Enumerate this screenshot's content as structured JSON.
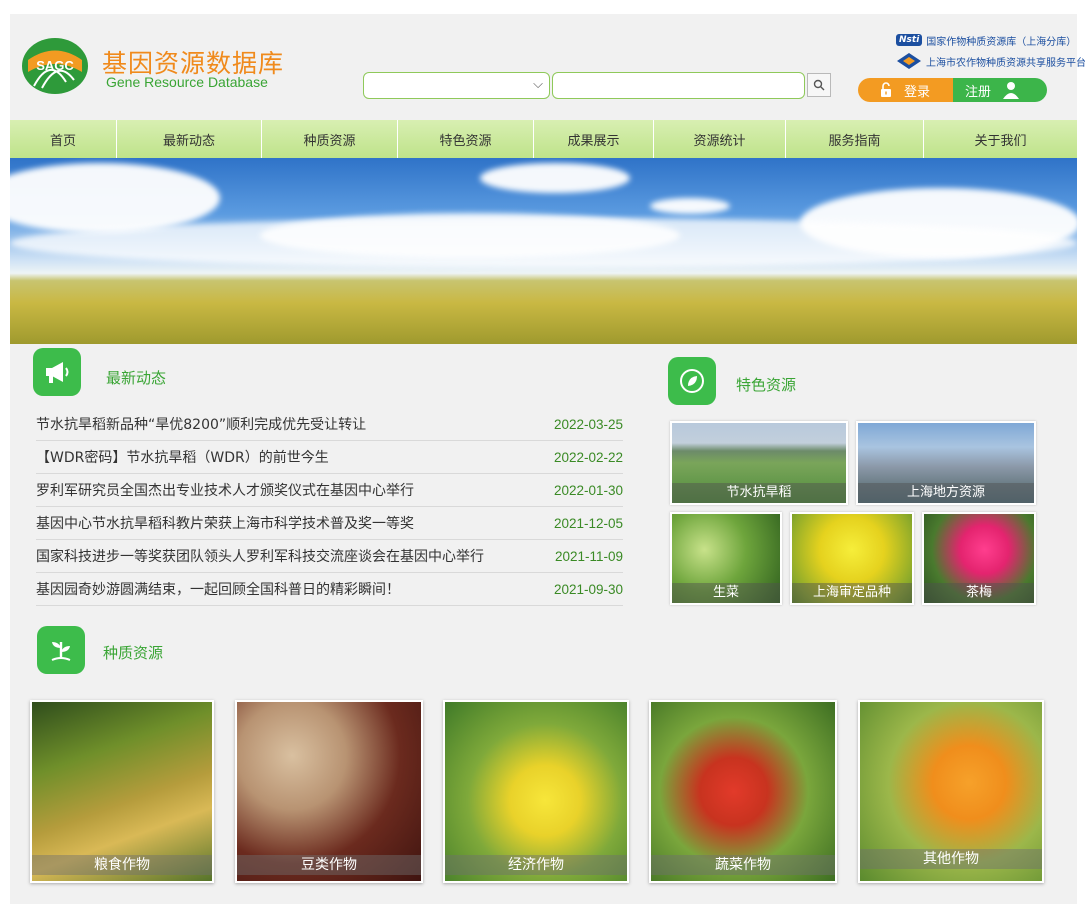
{
  "header": {
    "logo_text": "SAGC",
    "title": "基因资源数据库",
    "subtitle": "Gene Resource Database",
    "partner1": "国家作物种质资源库（上海分库）",
    "partner1_badge": "Nsti",
    "partner2": "上海市农作物种质资源共享服务平台",
    "login": "登录",
    "register": "注册"
  },
  "search": {
    "select_value": "",
    "input_value": ""
  },
  "nav": [
    "首页",
    "最新动态",
    "种质资源",
    "特色资源",
    "成果展示",
    "资源统计",
    "服务指南",
    "关于我们"
  ],
  "news": {
    "title": "最新动态",
    "items": [
      {
        "title": "节水抗旱稻新品种“旱优8200”顺利完成优先受让转让",
        "date": "2022-03-25"
      },
      {
        "title": "【WDR密码】节水抗旱稻（WDR）的前世今生",
        "date": "2022-02-22"
      },
      {
        "title": "罗利军研究员全国杰出专业技术人才颁奖仪式在基因中心举行",
        "date": "2022-01-30"
      },
      {
        "title": "基因中心节水抗旱稻科教片荣获上海市科学技术普及奖一等奖",
        "date": "2021-12-05"
      },
      {
        "title": "国家科技进步一等奖获团队领头人罗利军科技交流座谈会在基因中心举行",
        "date": "2021-11-09"
      },
      {
        "title": "基因园奇妙游圆满结束，一起回顾全国科普日的精彩瞬间！",
        "date": "2021-09-30"
      }
    ]
  },
  "featured": {
    "title": "特色资源",
    "items": [
      "节水抗旱稻",
      "上海地方资源",
      "生菜",
      "上海审定品种",
      "茶梅"
    ]
  },
  "germplasm": {
    "title": "种质资源",
    "items": [
      "粮食作物",
      "豆类作物",
      "经济作物",
      "蔬菜作物",
      "其他作物"
    ]
  },
  "colors": {
    "brand_green": "#3dbc4b",
    "brand_orange": "#f39b22",
    "nav_green": "#c9e89b"
  }
}
